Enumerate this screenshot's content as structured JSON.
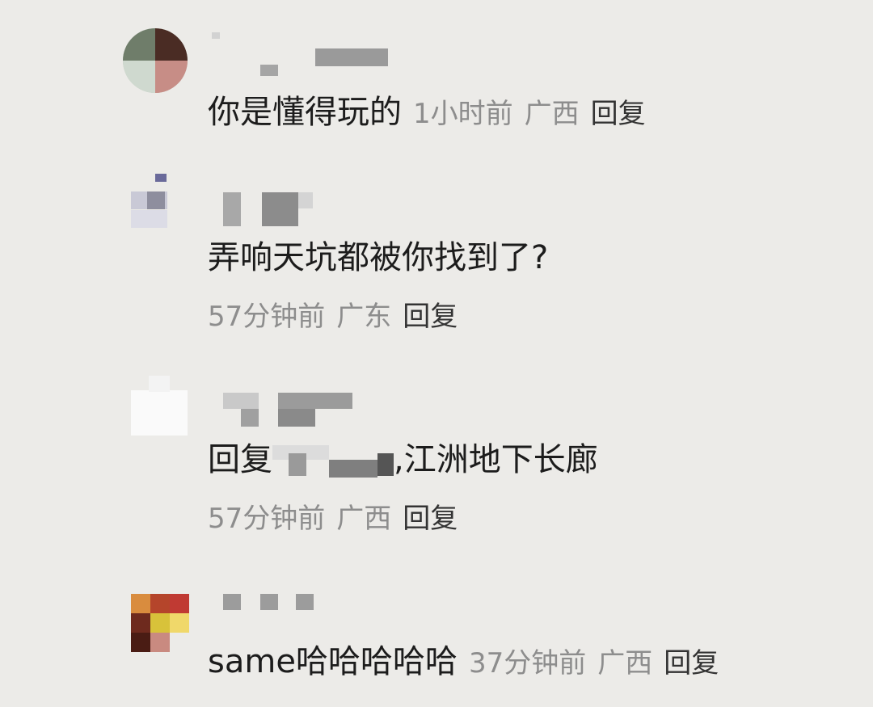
{
  "comments": [
    {
      "text": "你是懂得玩的",
      "time": "1小时前",
      "location": "广西",
      "reply_label": "回复"
    },
    {
      "text": "弄响天坑都被你找到了?",
      "time": "57分钟前",
      "location": "广东",
      "reply_label": "回复"
    },
    {
      "reply_prefix": "回复",
      "text": ",江洲地下长廊",
      "time": "57分钟前",
      "location": "广西",
      "reply_label": "回复"
    },
    {
      "text": "same哈哈哈哈哈",
      "time": "37分钟前",
      "location": "广西",
      "reply_label": "回复"
    }
  ]
}
